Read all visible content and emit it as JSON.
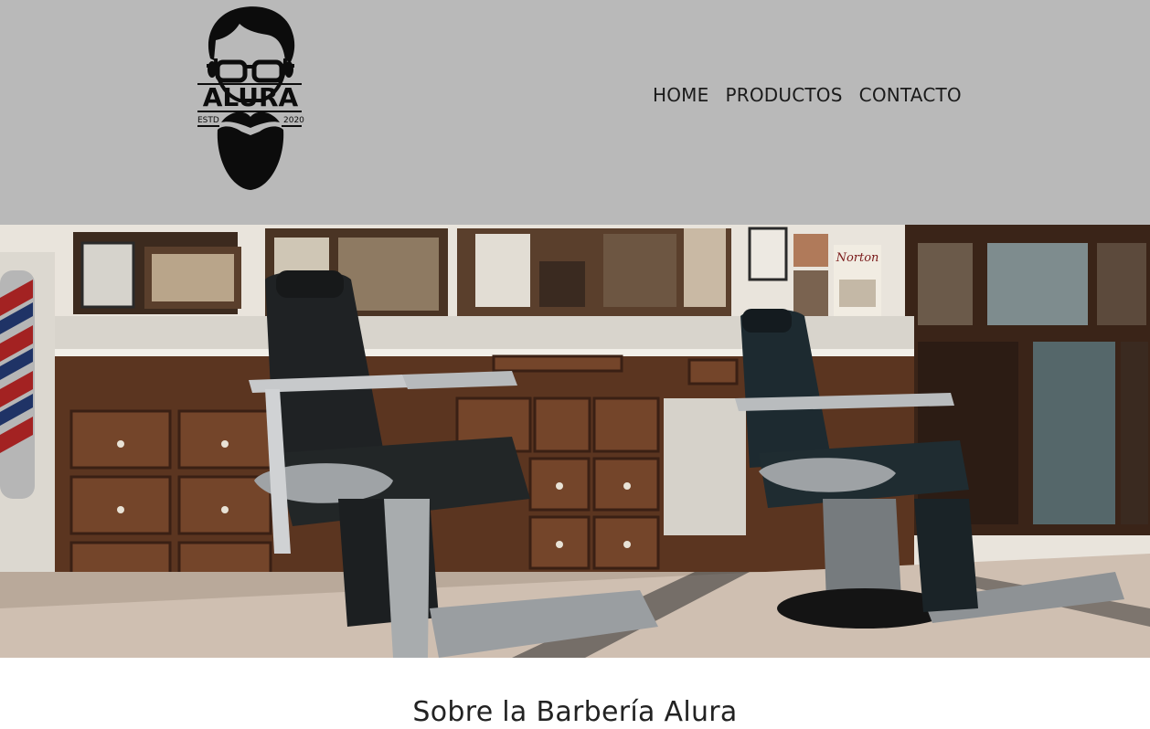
{
  "logo": {
    "brand": "ALURA",
    "estd_label": "ESTD",
    "year": "2020"
  },
  "nav": {
    "items": [
      {
        "label": "HOME"
      },
      {
        "label": "PRODUCTOS"
      },
      {
        "label": "CONTACTO"
      }
    ]
  },
  "hero": {
    "sign_text": "Norton"
  },
  "about": {
    "title": "Sobre la Barbería Alura"
  }
}
